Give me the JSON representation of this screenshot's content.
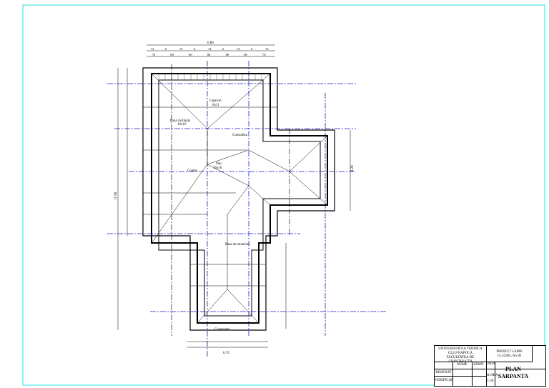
{
  "drawing": {
    "labels": {
      "capriori": "Capriori",
      "capriori_size": "6x11",
      "pana_inclinata": "Pana inclinata",
      "pana_size": "16x16",
      "pop": "Pop",
      "pop_size": "16x16",
      "pana_de_streasina": "Pana de streasina",
      "cosoroaba": "Cosoroaba",
      "coama": "Coama",
      "contrafisa": "Contrafisa"
    },
    "dimensions": {
      "overall_top": "6.80",
      "overall_bottom": "6.70",
      "top_row1": [
        "72",
        "6",
        "74",
        "6",
        "74",
        "6",
        "74",
        "6",
        "72"
      ],
      "top_row2": [
        "78",
        "80",
        "80",
        "80",
        "80",
        "80",
        "78"
      ],
      "left_total": "11.96",
      "right_total": "4.26"
    }
  },
  "title_block": {
    "university": "UNIVERSITATEA TEHNICA",
    "city": "CLUJ-NAPOCA",
    "faculty": "FACULTATEA DE CONSTRUCTII",
    "project": "PROIECT LEMN",
    "project_sub": "Gr.32305, An III",
    "col_name": "NUME",
    "col_sign": "SEMN.",
    "col_date": "DATA",
    "drawn": "DESENAT",
    "checked": "VERIFICAT",
    "scale_label": "SCARA",
    "scale": "1:50",
    "drawing_title_1": "PLAN",
    "drawing_title_2": "SARPANTA"
  }
}
